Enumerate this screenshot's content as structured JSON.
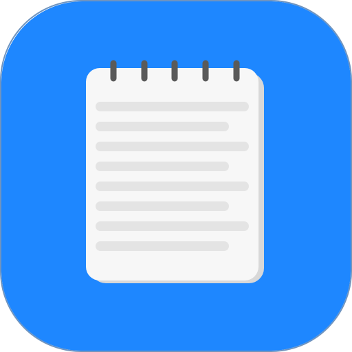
{
  "app_icon": {
    "icon": "notepad-icon",
    "background_color": "#1e87ff",
    "border_color": "#6f94bf",
    "paper": {
      "color": "#f7f7f7",
      "shadow_color": "#d8d8d8",
      "spiral_color": "#5a5a5a",
      "spiral_rings": 5,
      "text_lines": 8,
      "line_color": "#e4e4e4"
    }
  }
}
